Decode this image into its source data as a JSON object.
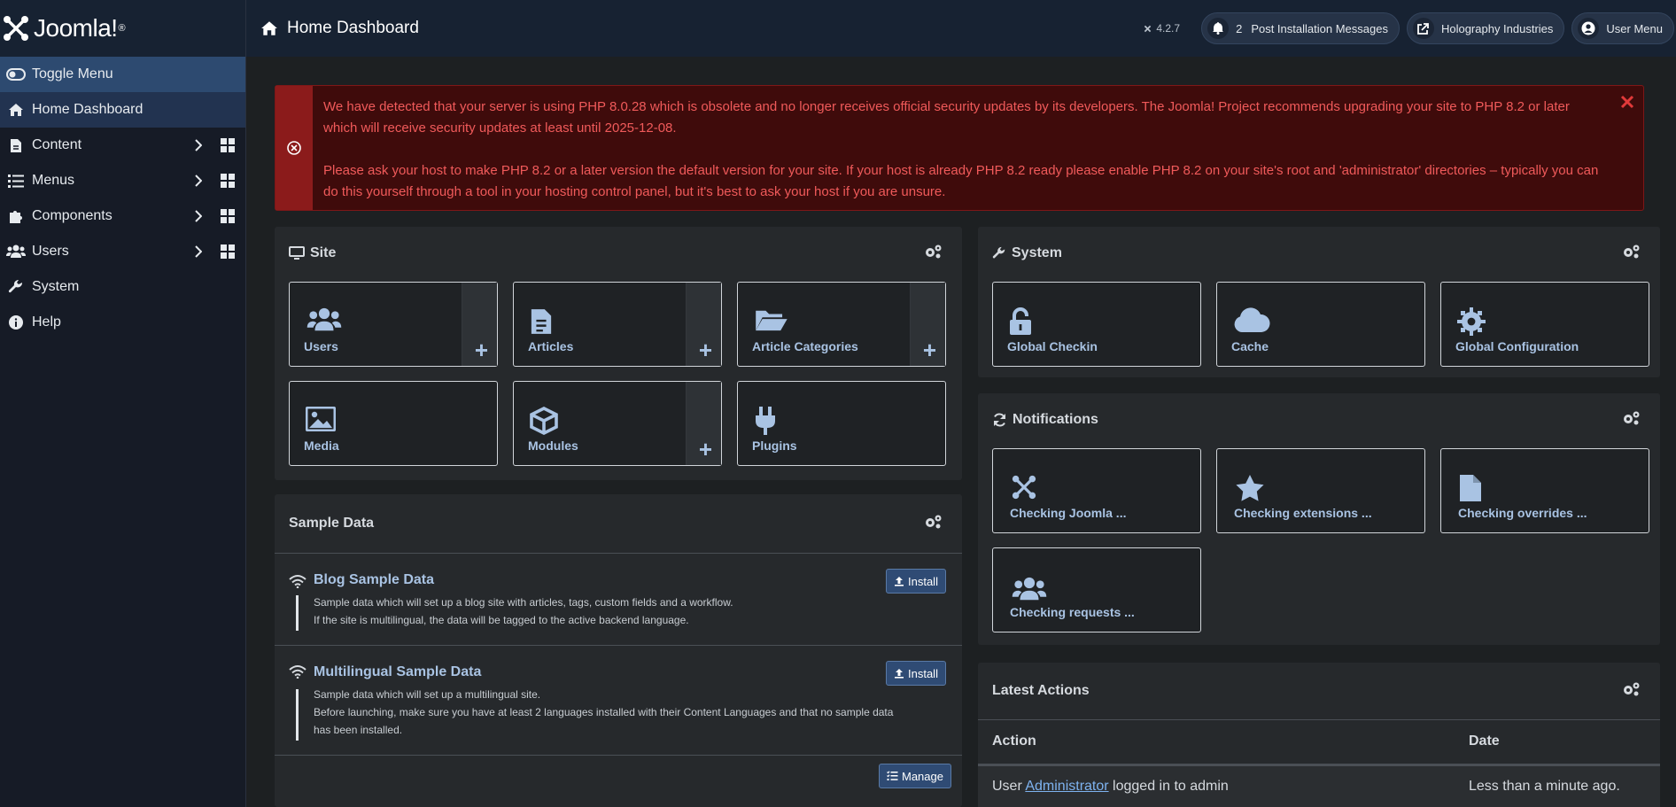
{
  "brand": {
    "name": "Joomla!"
  },
  "sidebar": {
    "toggle_label": "Toggle Menu",
    "items": [
      {
        "label": "Home Dashboard"
      },
      {
        "label": "Content"
      },
      {
        "label": "Menus"
      },
      {
        "label": "Components"
      },
      {
        "label": "Users"
      },
      {
        "label": "System"
      },
      {
        "label": "Help"
      }
    ]
  },
  "header": {
    "title": "Home Dashboard",
    "version": "4.2.7",
    "messages_count": "2",
    "messages_label": "Post Installation Messages",
    "site_label": "Holography Industries",
    "user_menu_label": "User Menu"
  },
  "alert": {
    "line1": "We have detected that your server is using PHP 8.0.28 which is obsolete and no longer receives official security updates by its developers. The Joomla! Project recommends upgrading your site to PHP 8.2 or later which will receive security updates at least until 2025-12-08.",
    "line2": "Please ask your host to make PHP 8.2 or a later version the default version for your site. If your host is already PHP 8.2 ready please enable PHP 8.2 on your site's root and 'administrator' directories – typically you can do this yourself through a tool in your hosting control panel, but it's best to ask your host if you are unsure."
  },
  "site_card": {
    "title": "Site",
    "tiles": [
      {
        "label": "Users"
      },
      {
        "label": "Articles"
      },
      {
        "label": "Article Categories"
      },
      {
        "label": "Media"
      },
      {
        "label": "Modules"
      },
      {
        "label": "Plugins"
      }
    ]
  },
  "system_card": {
    "title": "System",
    "tiles": [
      {
        "label": "Global Checkin"
      },
      {
        "label": "Cache"
      },
      {
        "label": "Global Configuration"
      }
    ]
  },
  "notifications_card": {
    "title": "Notifications",
    "tiles": [
      {
        "label": "Checking Joomla ..."
      },
      {
        "label": "Checking extensions ..."
      },
      {
        "label": "Checking overrides ..."
      },
      {
        "label": "Checking requests ..."
      }
    ]
  },
  "sample_data": {
    "title": "Sample Data",
    "items": [
      {
        "title": "Blog Sample Data",
        "desc1": "Sample data which will set up a blog site with articles, tags, custom fields and a workflow.",
        "desc2": "If the site is multilingual, the data will be tagged to the active backend language.",
        "button": "Install"
      },
      {
        "title": "Multilingual Sample Data",
        "desc1": "Sample data which will set up a multilingual site.",
        "desc2": "Before launching, make sure you have at least 2 languages installed with their Content Languages and that no sample data",
        "desc3": "has been installed.",
        "button": "Install"
      }
    ],
    "manage_button": "Manage"
  },
  "latest_actions": {
    "title": "Latest Actions",
    "col_action": "Action",
    "col_date": "Date",
    "row": {
      "prefix": "User",
      "user_link": "Administrator",
      "suffix": "logged in to admin",
      "date": "Less than a minute ago."
    }
  }
}
